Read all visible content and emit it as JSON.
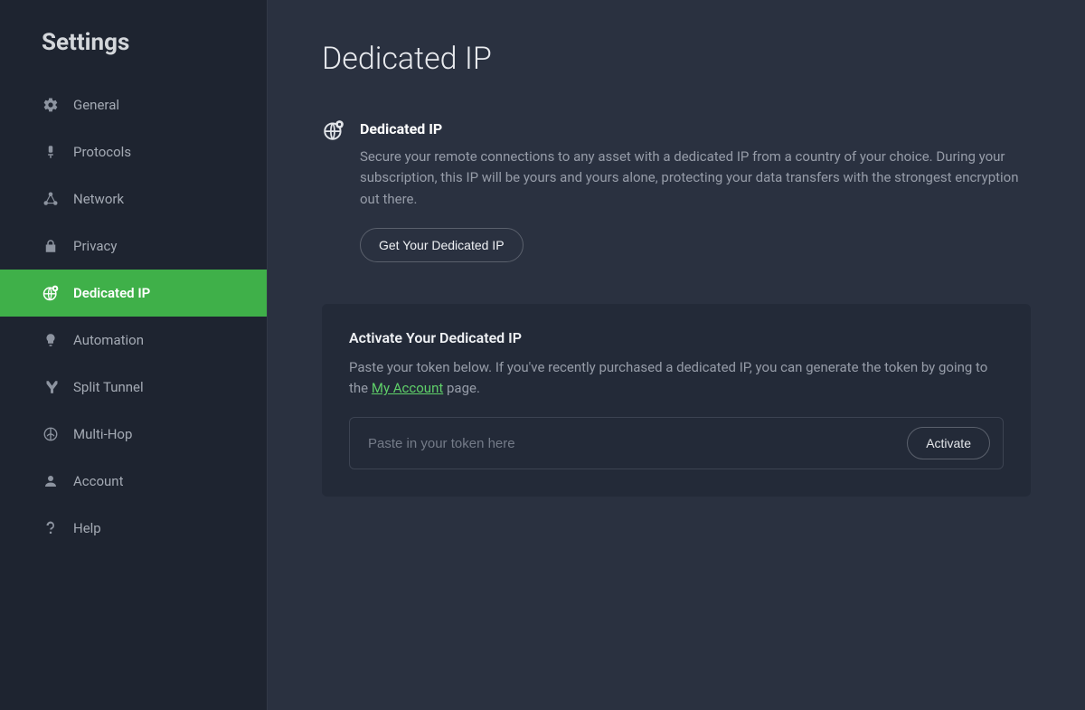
{
  "sidebar": {
    "title": "Settings",
    "items": [
      {
        "id": "general",
        "label": "General",
        "icon": "gear-icon"
      },
      {
        "id": "protocols",
        "label": "Protocols",
        "icon": "protocols-icon"
      },
      {
        "id": "network",
        "label": "Network",
        "icon": "network-icon"
      },
      {
        "id": "privacy",
        "label": "Privacy",
        "icon": "lock-icon"
      },
      {
        "id": "dedicated-ip",
        "label": "Dedicated IP",
        "icon": "globe-pin-icon",
        "active": true
      },
      {
        "id": "automation",
        "label": "Automation",
        "icon": "lightbulb-icon"
      },
      {
        "id": "split-tunnel",
        "label": "Split Tunnel",
        "icon": "split-icon"
      },
      {
        "id": "multi-hop",
        "label": "Multi-Hop",
        "icon": "multihop-icon"
      },
      {
        "id": "account",
        "label": "Account",
        "icon": "person-icon"
      },
      {
        "id": "help",
        "label": "Help",
        "icon": "question-icon"
      }
    ]
  },
  "page": {
    "title": "Dedicated IP",
    "section": {
      "title": "Dedicated IP",
      "description": "Secure your remote connections to any asset with a dedicated IP from a country of your choice. During your subscription, this IP will be yours and yours alone, protecting your data transfers with the strongest encryption out there.",
      "cta": "Get Your Dedicated IP"
    },
    "activate": {
      "title": "Activate Your Dedicated IP",
      "desc_prefix": "Paste your token below. If you've recently purchased a dedicated IP, you can generate the token by going to the ",
      "link_text": "My Account",
      "desc_suffix": " page.",
      "placeholder": "Paste in your token here",
      "button": "Activate"
    }
  },
  "colors": {
    "accent": "#3fb049",
    "link": "#5fd069",
    "bg": "#2a3140",
    "sidebar_bg": "#1e2430",
    "card_bg": "#232a38"
  }
}
